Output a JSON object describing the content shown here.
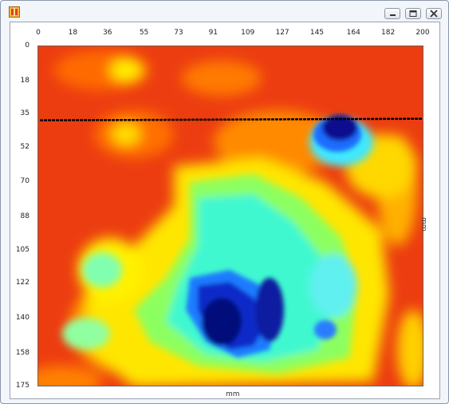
{
  "window": {
    "title": "",
    "icon": "app-icon",
    "buttons": [
      "minimize-icon",
      "maximize-icon",
      "close-icon"
    ]
  },
  "chart_data": {
    "type": "heatmap",
    "x_ticks": [
      "0",
      "18",
      "36",
      "55",
      "73",
      "91",
      "109",
      "127",
      "145",
      "164",
      "182",
      "200"
    ],
    "y_ticks": [
      "0",
      "18",
      "35",
      "52",
      "70",
      "88",
      "105",
      "122",
      "140",
      "158",
      "175"
    ],
    "xlabel": "mm",
    "ylabel": "mm",
    "xlim": [
      0,
      200
    ],
    "ylim": [
      0,
      175
    ],
    "colormap": [
      "#0a0a8c",
      "#00ffff",
      "#ffff00",
      "#ff2a00"
    ],
    "scan_line_y_mm": 38,
    "grid": false,
    "legend": "none"
  },
  "colors": {
    "background_hot": "#ee3f0e",
    "scan_line": "#000000"
  }
}
